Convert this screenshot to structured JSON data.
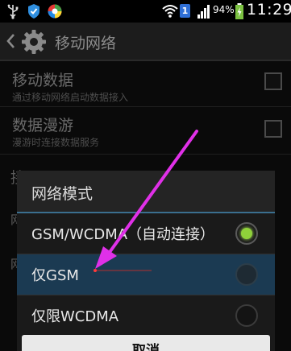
{
  "status_bar": {
    "sim_badge": "1",
    "battery_percent": "94%",
    "time": "11:29",
    "icons": [
      "usb-icon",
      "shield-icon",
      "app-notification-icon",
      "wifi-icon",
      "sim-icon",
      "signal-icon",
      "battery-charging-icon"
    ]
  },
  "action_bar": {
    "title": "移动网络",
    "icons": [
      "back-chevron-icon",
      "gear-icon"
    ]
  },
  "settings": {
    "mobile_data": {
      "title": "移动数据",
      "subtitle": "通过移动网络启动数据接入",
      "checked": false
    },
    "roaming": {
      "title": "数据漫游",
      "subtitle": "漫游时连接数据服务",
      "checked": false
    },
    "partial_row_1": "接",
    "partial_row_2": "网",
    "partial_row_3": "网"
  },
  "dialog": {
    "title": "网络模式",
    "options": [
      {
        "label": "GSM/WCDMA（自动连接）",
        "selected": true
      },
      {
        "label": "仅GSM",
        "selected": false,
        "highlighted": true
      },
      {
        "label": "仅限WCDMA",
        "selected": false
      }
    ],
    "cancel_label": "取消"
  },
  "colors": {
    "selected_radio": "#8fd13a",
    "highlight_row": "#1b3a52",
    "annotation_arrow": "#e030e8"
  }
}
